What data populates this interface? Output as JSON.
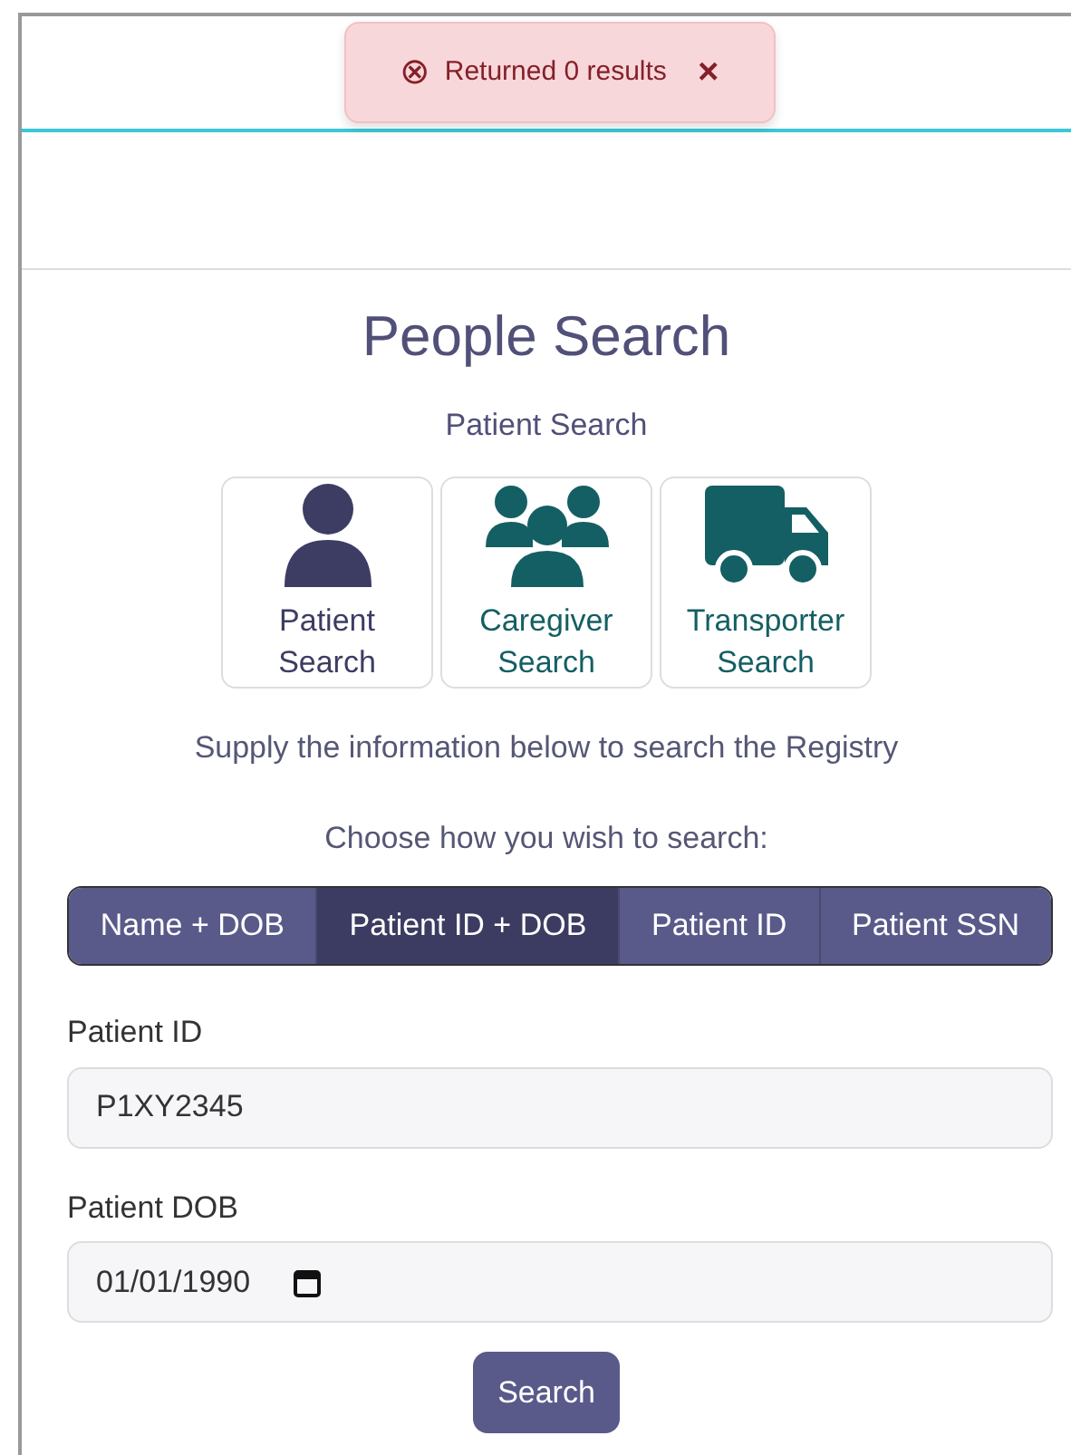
{
  "toast": {
    "icon": "⊗",
    "message": "Returned 0 results",
    "close": "×"
  },
  "title": "People Search",
  "subtitle": "Patient Search",
  "search_types": [
    {
      "label": "Patient Search",
      "kind": "person",
      "selected": true
    },
    {
      "label": "Caregiver Search",
      "kind": "group",
      "selected": false
    },
    {
      "label": "Transporter Search",
      "kind": "truck",
      "selected": false
    }
  ],
  "instructions": "Supply the information below to search the Registry",
  "choose_label": "Choose how you wish to search:",
  "modes": [
    {
      "label": "Name + DOB",
      "selected": false
    },
    {
      "label": "Patient ID + DOB",
      "selected": true
    },
    {
      "label": "Patient ID",
      "selected": false
    },
    {
      "label": "Patient SSN",
      "selected": false
    }
  ],
  "fields": [
    {
      "label": "Patient ID",
      "kind": "text",
      "value": "P1XY2345"
    },
    {
      "label": "Patient DOB",
      "kind": "date",
      "value": "01/01/1990"
    }
  ],
  "search_button": "Search"
}
